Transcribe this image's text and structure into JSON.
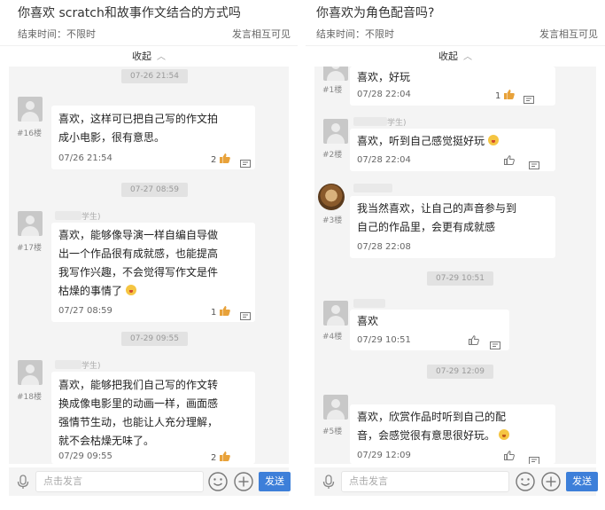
{
  "left": {
    "title": "你喜欢 scratch和故事作文结合的方式吗",
    "end_time": "结束时间：不限时",
    "visibility": "发言相互可见",
    "collapse": "收起",
    "times": [
      "07-26 21:54",
      "07-27 08:59",
      "07-29 09:55"
    ],
    "posts": [
      {
        "floor": "#16楼",
        "name": "",
        "text": [
          "喜欢，这样可已把自己写的作文拍",
          "成小电影，很有意思。"
        ],
        "ts": "07/26 21:54",
        "likes": "2"
      },
      {
        "floor": "#17楼",
        "name": "学生)",
        "text": [
          "喜欢，能够像导演一样自编自导做",
          "出一个作品很有成就感，也能提高",
          "我写作兴趣，不会觉得写作文是件",
          "枯燥的事情了"
        ],
        "ts": "07/27 08:59",
        "likes": "1"
      },
      {
        "floor": "#18楼",
        "name": "学生)",
        "text": [
          "喜欢，能够把我们自己写的作文转",
          "换成像电影里的动画一样，画面感",
          "强情节生动，也能让人充分理解，",
          "就不会枯燥无味了。"
        ],
        "ts": "07/29 09:55",
        "likes": "2"
      }
    ],
    "input_placeholder": "点击发言",
    "send": "发送"
  },
  "right": {
    "title": "你喜欢为角色配音吗?",
    "end_time": "结束时间：不限时",
    "visibility": "发言相互可见",
    "collapse": "收起",
    "times": [
      "07-29 10:51",
      "07-29 12:09"
    ],
    "posts": [
      {
        "floor": "#1楼",
        "name": "",
        "text": [
          "喜欢，好玩"
        ],
        "ts": "07/28 22:04",
        "likes": "1"
      },
      {
        "floor": "#2楼",
        "name": "学生)",
        "text": [
          "喜欢，听到自己感觉挺好玩"
        ],
        "ts": "07/28 22:04",
        "likes": ""
      },
      {
        "floor": "#3楼",
        "name": "",
        "text": [
          "我当然喜欢，让自己的声音参与到",
          "自己的作品里，会更有成就感"
        ],
        "ts": "07/28 22:08",
        "likes": ""
      },
      {
        "floor": "#4楼",
        "name": "",
        "text": [
          "喜欢"
        ],
        "ts": "07/29 10:51",
        "likes": ""
      },
      {
        "floor": "#5楼",
        "name": "",
        "text": [
          "喜欢，欣赏作品时听到自己的配",
          "音，会感觉很有意思很好玩。"
        ],
        "ts": "07/29 12:09",
        "likes": ""
      }
    ],
    "input_placeholder": "点击发言",
    "send": "发送"
  },
  "icons": {
    "like": "thumbs-up-icon",
    "comment": "comment-icon",
    "mic": "microphone-icon",
    "emoji": "smiley-icon",
    "plus": "plus-icon",
    "avatar": "default-avatar-icon"
  },
  "colors": {
    "accent": "#3d7fd9",
    "chat_bg": "#f4f4f4",
    "like": "#e8a23a"
  }
}
